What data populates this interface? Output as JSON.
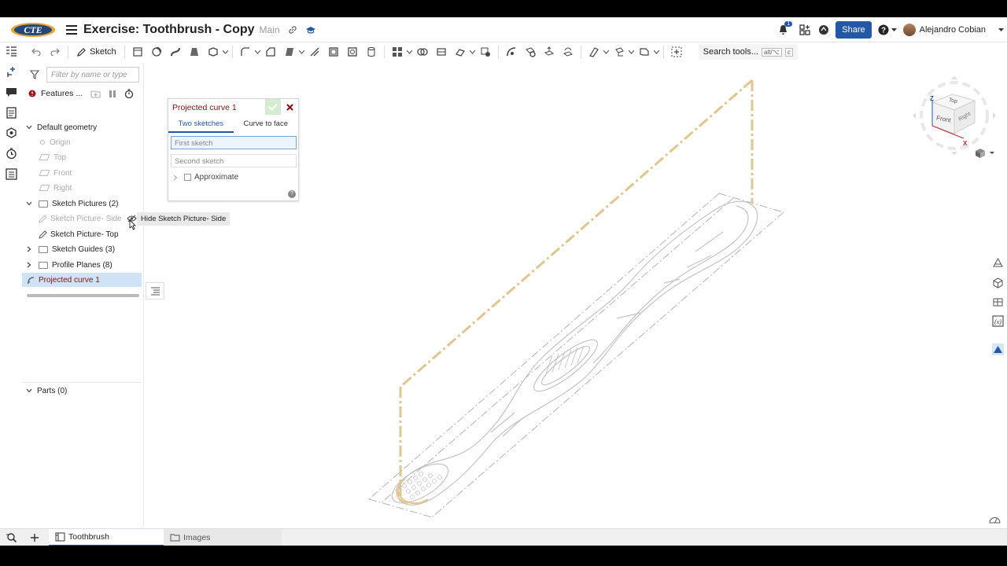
{
  "header": {
    "logo_text": "CTE",
    "doc_title": "Exercise: Toothbrush - Copy",
    "branch": "Main",
    "notification_count": "1",
    "share_label": "Share",
    "user_name": "Alejandro Cobian"
  },
  "toolbar": {
    "sketch_label": "Sketch",
    "search_label": "Search tools...",
    "search_shortcut": "alt/⌥",
    "search_shortcut2": "c"
  },
  "tree": {
    "filter_placeholder": "Filter by name or type",
    "features_label": "Features ...",
    "items": [
      {
        "label": "Default geometry"
      },
      {
        "label": "Origin"
      },
      {
        "label": "Top"
      },
      {
        "label": "Front"
      },
      {
        "label": "Right"
      },
      {
        "label": "Sketch Pictures (2)"
      },
      {
        "label": "Sketch Picture- Side"
      },
      {
        "label": "Sketch Picture- Top"
      },
      {
        "label": "Sketch Guides (3)"
      },
      {
        "label": "Profile Planes (8)"
      },
      {
        "label": "Projected curve 1"
      }
    ],
    "parts_label": "Parts (0)",
    "tooltip": "Hide Sketch Picture- Side"
  },
  "dialog": {
    "title": "Projected curve 1",
    "tabs": [
      "Two sketches",
      "Curve to face"
    ],
    "first_sketch": "First sketch",
    "second_sketch": "Second sketch",
    "approximate_label": "Approximate",
    "help": "?"
  },
  "viewcube": {
    "top": "Top",
    "front": "Front",
    "right": "Right",
    "z": "Z",
    "x": "X"
  },
  "bottom": {
    "tabs": [
      {
        "label": "Toothbrush"
      },
      {
        "label": "Images"
      }
    ]
  },
  "colors": {
    "accent": "#2358a6",
    "selection_text": "#8b1010",
    "plane_line": "#e2c68f"
  }
}
